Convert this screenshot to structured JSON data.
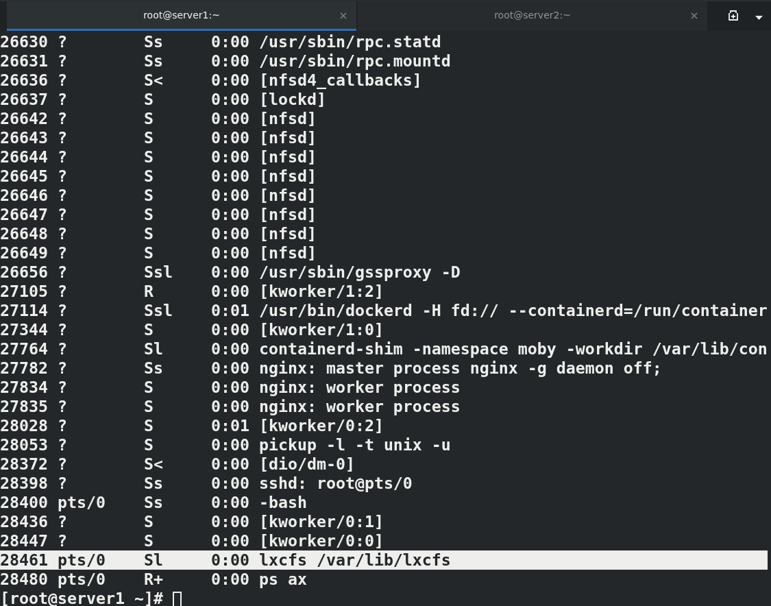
{
  "tabs": [
    {
      "title": "root@server1:~",
      "selected": true
    },
    {
      "title": "root@server2:~",
      "selected": false
    }
  ],
  "processes": [
    {
      "pid": "26630",
      "tty": "?",
      "stat": "Ss",
      "time": "0:00",
      "command": "/usr/sbin/rpc.statd",
      "selected": false
    },
    {
      "pid": "26631",
      "tty": "?",
      "stat": "Ss",
      "time": "0:00",
      "command": "/usr/sbin/rpc.mountd",
      "selected": false
    },
    {
      "pid": "26636",
      "tty": "?",
      "stat": "S<",
      "time": "0:00",
      "command": "[nfsd4_callbacks]",
      "selected": false
    },
    {
      "pid": "26637",
      "tty": "?",
      "stat": "S",
      "time": "0:00",
      "command": "[lockd]",
      "selected": false
    },
    {
      "pid": "26642",
      "tty": "?",
      "stat": "S",
      "time": "0:00",
      "command": "[nfsd]",
      "selected": false
    },
    {
      "pid": "26643",
      "tty": "?",
      "stat": "S",
      "time": "0:00",
      "command": "[nfsd]",
      "selected": false
    },
    {
      "pid": "26644",
      "tty": "?",
      "stat": "S",
      "time": "0:00",
      "command": "[nfsd]",
      "selected": false
    },
    {
      "pid": "26645",
      "tty": "?",
      "stat": "S",
      "time": "0:00",
      "command": "[nfsd]",
      "selected": false
    },
    {
      "pid": "26646",
      "tty": "?",
      "stat": "S",
      "time": "0:00",
      "command": "[nfsd]",
      "selected": false
    },
    {
      "pid": "26647",
      "tty": "?",
      "stat": "S",
      "time": "0:00",
      "command": "[nfsd]",
      "selected": false
    },
    {
      "pid": "26648",
      "tty": "?",
      "stat": "S",
      "time": "0:00",
      "command": "[nfsd]",
      "selected": false
    },
    {
      "pid": "26649",
      "tty": "?",
      "stat": "S",
      "time": "0:00",
      "command": "[nfsd]",
      "selected": false
    },
    {
      "pid": "26656",
      "tty": "?",
      "stat": "Ssl",
      "time": "0:00",
      "command": "/usr/sbin/gssproxy -D",
      "selected": false
    },
    {
      "pid": "27105",
      "tty": "?",
      "stat": "R",
      "time": "0:00",
      "command": "[kworker/1:2]",
      "selected": false
    },
    {
      "pid": "27114",
      "tty": "?",
      "stat": "Ssl",
      "time": "0:01",
      "command": "/usr/bin/dockerd -H fd:// --containerd=/run/container",
      "selected": false
    },
    {
      "pid": "27344",
      "tty": "?",
      "stat": "S",
      "time": "0:00",
      "command": "[kworker/1:0]",
      "selected": false
    },
    {
      "pid": "27764",
      "tty": "?",
      "stat": "Sl",
      "time": "0:00",
      "command": "containerd-shim -namespace moby -workdir /var/lib/con",
      "selected": false
    },
    {
      "pid": "27782",
      "tty": "?",
      "stat": "Ss",
      "time": "0:00",
      "command": "nginx: master process nginx -g daemon off;",
      "selected": false
    },
    {
      "pid": "27834",
      "tty": "?",
      "stat": "S",
      "time": "0:00",
      "command": "nginx: worker process",
      "selected": false
    },
    {
      "pid": "27835",
      "tty": "?",
      "stat": "S",
      "time": "0:00",
      "command": "nginx: worker process",
      "selected": false
    },
    {
      "pid": "28028",
      "tty": "?",
      "stat": "S",
      "time": "0:01",
      "command": "[kworker/0:2]",
      "selected": false
    },
    {
      "pid": "28053",
      "tty": "?",
      "stat": "S",
      "time": "0:00",
      "command": "pickup -l -t unix -u",
      "selected": false
    },
    {
      "pid": "28372",
      "tty": "?",
      "stat": "S<",
      "time": "0:00",
      "command": "[dio/dm-0]",
      "selected": false
    },
    {
      "pid": "28398",
      "tty": "?",
      "stat": "Ss",
      "time": "0:00",
      "command": "sshd: root@pts/0",
      "selected": false
    },
    {
      "pid": "28400",
      "tty": "pts/0",
      "stat": "Ss",
      "time": "0:00",
      "command": "-bash",
      "selected": false
    },
    {
      "pid": "28436",
      "tty": "?",
      "stat": "S",
      "time": "0:00",
      "command": "[kworker/0:1]",
      "selected": false
    },
    {
      "pid": "28447",
      "tty": "?",
      "stat": "S",
      "time": "0:00",
      "command": "[kworker/0:0]",
      "selected": false
    },
    {
      "pid": "28461",
      "tty": "pts/0",
      "stat": "Sl",
      "time": "0:00",
      "command": "lxcfs /var/lib/lxcfs",
      "selected": true
    },
    {
      "pid": "28480",
      "tty": "pts/0",
      "stat": "R+",
      "time": "0:00",
      "command": "ps ax",
      "selected": false
    }
  ],
  "prompt": "[root@server1 ~]#"
}
